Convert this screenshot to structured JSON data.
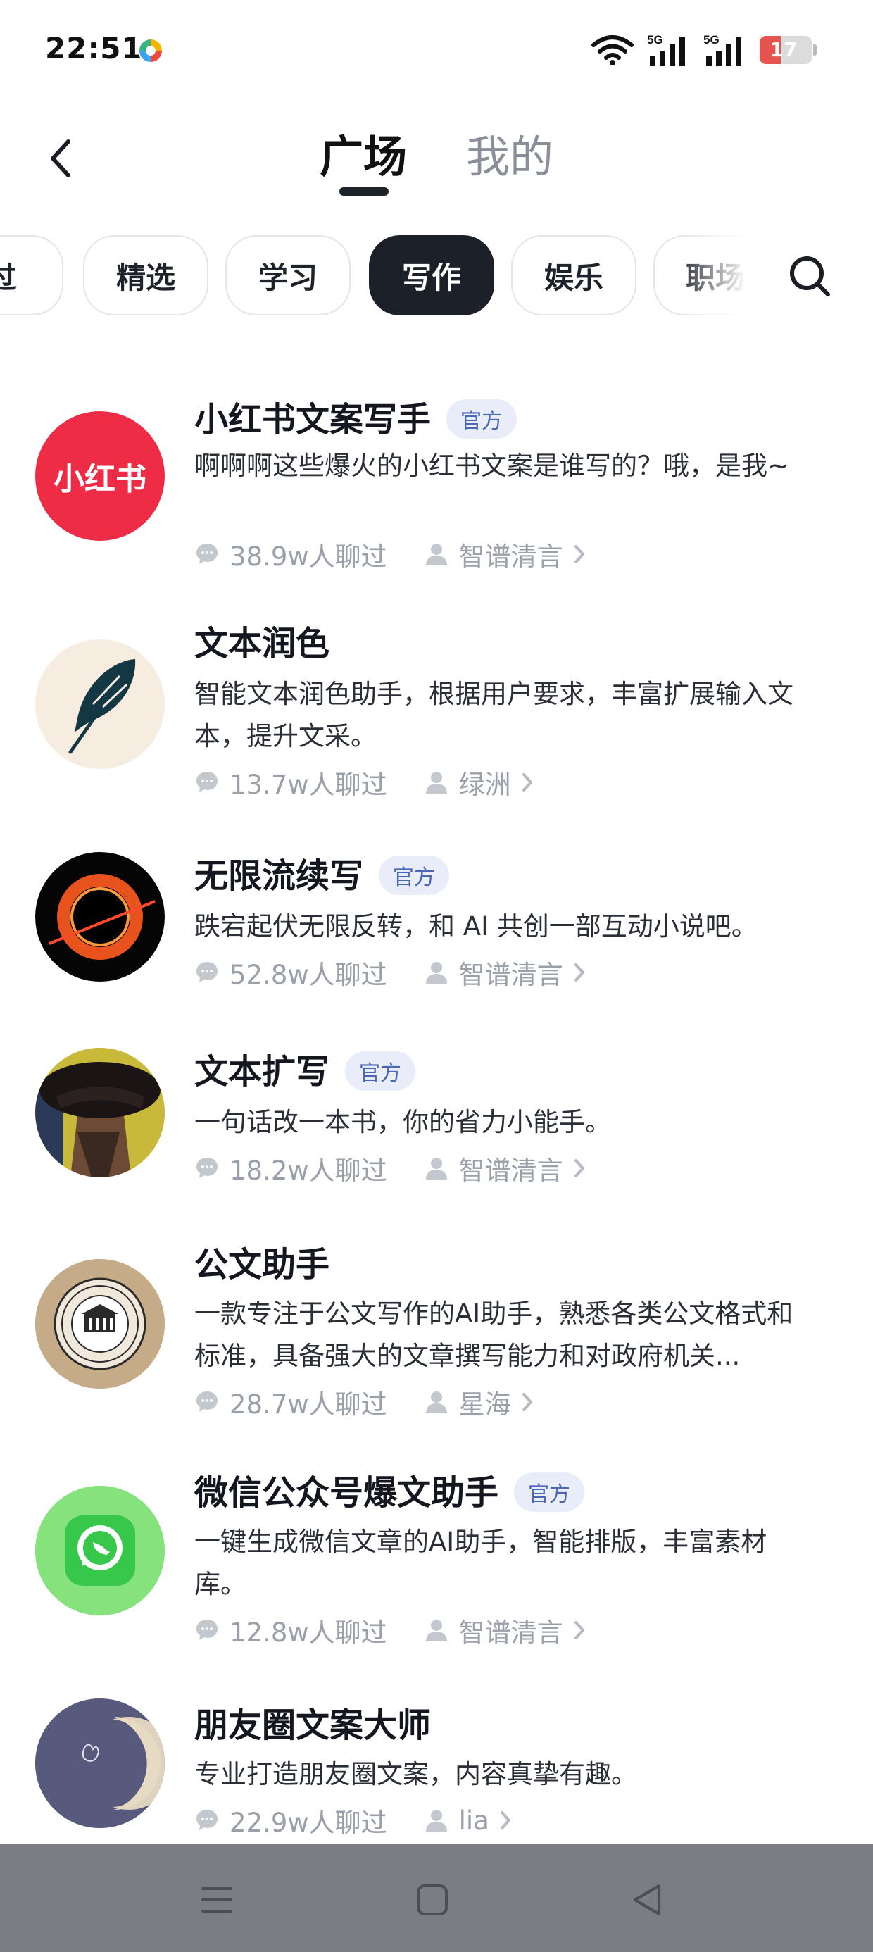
{
  "status_bar": {
    "time": "22:51",
    "battery_level": "17",
    "signal_1": "5G",
    "signal_2": "5G",
    "battery_color": "#e5544f"
  },
  "header": {
    "tabs": [
      {
        "label": "广场",
        "active": true
      },
      {
        "label": "我的",
        "active": false
      }
    ]
  },
  "categories": [
    "过",
    "精选",
    "学习",
    "写作",
    "娱乐",
    "职场"
  ],
  "active_category": "写作",
  "badge_label": "官方",
  "items": [
    {
      "title": "小红书文案写手",
      "official": true,
      "desc": "啊啊啊这些爆火的小红书文案是谁写的？哦，是我~",
      "chats": "38.9w人聊过",
      "author": "智谱清言",
      "avatar_icon": "xiaohongshu-logo",
      "avatar_text": "小红书"
    },
    {
      "title": "文本润色",
      "official": false,
      "desc": "智能文本润色助手，根据用户要求，丰富扩展输入文本，提升文采。",
      "chats": "13.7w人聊过",
      "author": "绿洲",
      "avatar_icon": "feather-icon"
    },
    {
      "title": "无限流续写",
      "official": true,
      "desc": "跌宕起伏无限反转，和 AI 共创一部互动小说吧。",
      "chats": "52.8w人聊过",
      "author": "智谱清言",
      "avatar_icon": "black-hole-icon"
    },
    {
      "title": "文本扩写",
      "official": true,
      "desc": "一句话改一本书，你的省力小能手。",
      "chats": "18.2w人聊过",
      "author": "智谱清言",
      "avatar_icon": "portrait-avatar"
    },
    {
      "title": "公文助手",
      "official": false,
      "desc": "一款专注于公文写作的AI助手，熟悉各类公文格式和标准，具备强大的文章撰写能力和对政府机关...",
      "chats": "28.7w人聊过",
      "author": "星海",
      "avatar_icon": "seal-emblem"
    },
    {
      "title": "微信公众号爆文助手",
      "official": true,
      "desc": "一键生成微信文章的AI助手，智能排版，丰富素材库。",
      "chats": "12.8w人聊过",
      "author": "智谱清言",
      "avatar_icon": "wechat-bubble-icon"
    },
    {
      "title": "朋友圈文案大师",
      "official": false,
      "desc": "专业打造朋友圈文案，内容真挚有趣。",
      "chats": "22.9w人聊过",
      "author": "lia",
      "avatar_icon": "moon-icon"
    }
  ],
  "nav_bar": {
    "buttons": [
      "menu-icon",
      "home-square-icon",
      "back-triangle-icon"
    ]
  }
}
